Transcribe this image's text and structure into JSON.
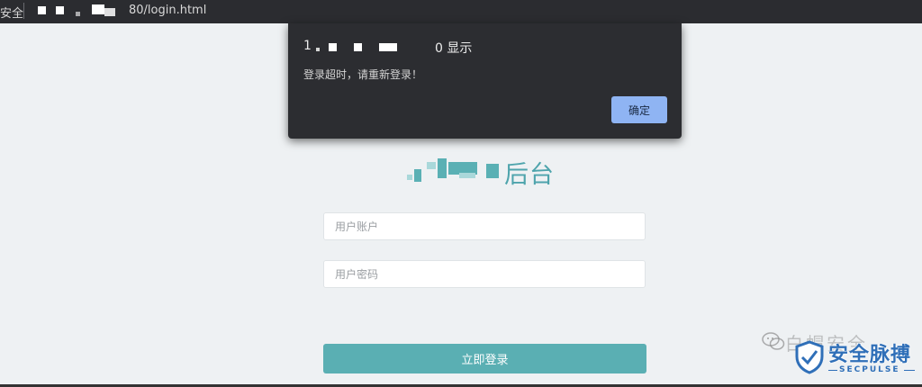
{
  "address_bar": {
    "security_label": "安全",
    "url_visible": "80/login.html"
  },
  "dialog": {
    "header_start": "1",
    "header_end": "0 显示",
    "message": "登录超时，请重新登录！",
    "ok_label": "确定"
  },
  "login": {
    "title_suffix": "后台",
    "username_placeholder": "用户账户",
    "password_placeholder": "用户密码",
    "submit_label": "立即登录"
  },
  "watermark": {
    "small_text": "白帽安全",
    "brand_cn": "安全脉搏",
    "brand_en": "SECPULSE"
  },
  "colors": {
    "accent": "#5aafb3",
    "dialog_bg": "#2c2d31",
    "dialog_button": "#8fb4f3",
    "brand_blue": "#2f6fb8"
  }
}
